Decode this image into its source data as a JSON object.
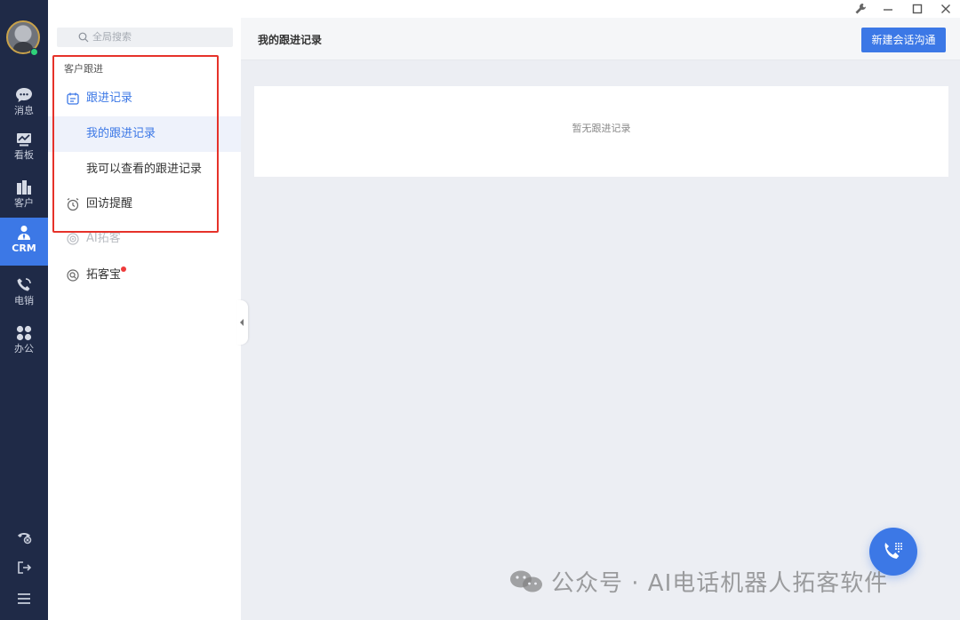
{
  "rail": {
    "items": [
      {
        "label": "消息",
        "icon": "chat-bubble-icon"
      },
      {
        "label": "看板",
        "icon": "dashboard-icon"
      },
      {
        "label": "客户",
        "icon": "customer-icon"
      },
      {
        "label": "CRM",
        "icon": "crm-person-icon"
      },
      {
        "label": "电销",
        "icon": "phone-icon"
      },
      {
        "label": "办公",
        "icon": "apps-grid-icon"
      }
    ],
    "active": "CRM",
    "bottom_icons": [
      "phone-settings-icon",
      "logout-icon",
      "menu-hamburger-icon"
    ]
  },
  "sidebar": {
    "search_placeholder": "全局搜索",
    "group_label": "客户跟进",
    "items": [
      {
        "label": "跟进记录",
        "icon": "follow-record-icon"
      },
      {
        "label": "我的跟进记录"
      },
      {
        "label": "我可以查看的跟进记录"
      },
      {
        "label": "回访提醒",
        "icon": "alarm-clock-icon"
      },
      {
        "label": "AI拓客",
        "icon": "ai-radar-icon"
      },
      {
        "label": "拓客宝",
        "icon": "search-target-icon"
      }
    ]
  },
  "window_controls": [
    "wrench-icon",
    "minimize-icon",
    "maximize-icon",
    "close-icon"
  ],
  "header": {
    "title": "我的跟进记录",
    "new_button": "新建会话沟通"
  },
  "content": {
    "empty_text": "暂无跟进记录"
  },
  "watermark": "公众号 · AI电话机器人拓客软件",
  "colors": {
    "rail_bg": "#1f2a47",
    "accent": "#3c78e6",
    "highlight_box": "#e6322a",
    "page_bg": "#eceef3",
    "red_dot": "#ee3b3b"
  }
}
